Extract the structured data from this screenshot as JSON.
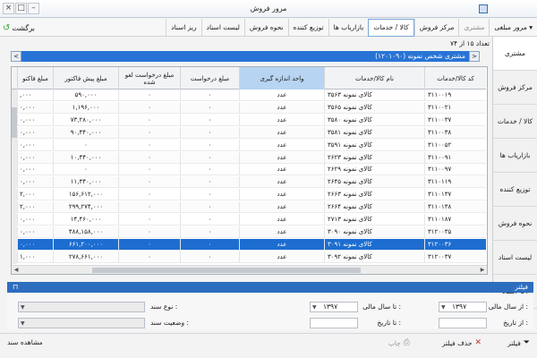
{
  "window": {
    "title": "مرور فروش"
  },
  "toolbar": {
    "back_label": "برگشت",
    "tabs": [
      {
        "label": "مرور مبلغی",
        "dropdown": true
      },
      {
        "label": "مشتری",
        "disabled": true
      },
      {
        "label": "مرکز فروش"
      },
      {
        "label": "کالا / خدمات",
        "active": true
      },
      {
        "label": "بازاریاب ها"
      },
      {
        "label": "توزیع کننده"
      },
      {
        "label": "نحوه فروش"
      },
      {
        "label": "لیست اسناد"
      },
      {
        "label": "ریز اسناد"
      }
    ]
  },
  "sidebar": {
    "items": [
      {
        "label": "مشتری",
        "active": true
      },
      {
        "label": "مرکز فروش"
      },
      {
        "label": "کالا / خدمات"
      },
      {
        "label": "بازاریاب ها"
      },
      {
        "label": "توزیع کننده"
      },
      {
        "label": "نحوه فروش"
      },
      {
        "label": "لیست اسناد"
      },
      {
        "label": "ریز اسناد"
      }
    ]
  },
  "header": {
    "count": "تعداد ۱۵ از ۷۴",
    "customer": "مشتری شخص نمونه (۱۲۰۱۰۹۰)",
    "prev": "<",
    "next": ">"
  },
  "grid": {
    "columns": [
      "کد کالا/خدمات",
      "نام کالا/خدمات",
      "واحد اندازه گیری",
      "مبلغ درخواست",
      "مبلغ درخواست لغو شده",
      "مبلغ پیش فاکتور",
      "مبلغ فاکتو"
    ],
    "rows": [
      [
        "۳۱۱۰۰۱۹",
        "کالای نمونه ۳۵۶۳",
        "عدد",
        "۰",
        "۰",
        "۵۹۰,۰۰۰",
        ",۰۰۰"
      ],
      [
        "۳۱۱۰۰۲۱",
        "کالای نمونه ۳۵۶۵",
        "عدد",
        "۰",
        "۰",
        "۱,۱۹۶,۰۰۰",
        "۰,۰۰۰"
      ],
      [
        "۳۱۱۰۰۳۷",
        "کالای نمونه ۳۵۸۰",
        "عدد",
        "۰",
        "۰",
        "۷۳,۲۸۰,۰۰۰",
        "۰,۰۰۰"
      ],
      [
        "۳۱۱۰۰۳۸",
        "کالای نمونه ۳۵۸۱",
        "عدد",
        "۰",
        "۰",
        "۹۰,۴۴۰,۰۰۰",
        "۰,۰۰۰"
      ],
      [
        "۳۱۱۰۰۵۲",
        "کالای نمونه ۳۵۹۱",
        "عدد",
        "۰",
        "۰",
        "۰",
        "۰,۰۰۰"
      ],
      [
        "۳۱۱۰۰۹۱",
        "کالای نمونه ۲۶۲۳",
        "عدد",
        "۰",
        "۰",
        "۱۰,۴۴۰,۰۰۰",
        "۰,۰۰۰"
      ],
      [
        "۳۱۱۰۰۹۷",
        "کالای نمونه ۲۶۲۹",
        "عدد",
        "۰",
        "۰",
        "۰",
        "۰,۰۰۰"
      ],
      [
        "۳۱۱۰۱۱۹",
        "کالای نمونه ۲۶۴۵",
        "عدد",
        "۰",
        "۰",
        "۱۱,۴۴۰,۰۰۰",
        "۰,۰۰۰"
      ],
      [
        "۳۱۱۰۱۳۷",
        "کالای نمونه ۲۶۶۳",
        "عدد",
        "۰",
        "۰",
        "۱۵۶,۶۱۲,۰۰۰",
        "۲,۰۰۰"
      ],
      [
        "۳۱۱۰۱۳۸",
        "کالای نمونه ۲۶۶۴",
        "عدد",
        "۰",
        "۰",
        "۲۹۹,۲۷۴,۰۰۰",
        "۲,۰۰۰"
      ],
      [
        "۳۱۱۰۱۸۷",
        "کالای نمونه ۲۷۱۳",
        "عدد",
        "۰",
        "۰",
        "۱۴,۴۶۰,۰۰۰",
        "۰,۰۰۰"
      ],
      [
        "۳۱۲۰۰۳۵",
        "کالای نمونه ۳۰۹۰",
        "عدد",
        "۰",
        "۰",
        "۴۸۸,۱۵۸,۰۰۰",
        "۰,۰۰۰"
      ],
      [
        "۳۱۲۰۰۳۶",
        "کالای نمونه ۳۰۹۱",
        "عدد",
        "۰",
        "۰",
        "۶۶۱,۲۰۰,۰۰۰",
        "۰,۰۰۰"
      ],
      [
        "۳۱۲۰۰۳۷",
        "کالای نمونه ۳۰۹۲",
        "عدد",
        "۰",
        "۰",
        "۲۷۸,۶۶۱,۰۰۰",
        "۱,۰۰۰"
      ]
    ],
    "selected_row": 12
  },
  "filter": {
    "title": "فیلتر",
    "from_year_label": "از سال مالی :",
    "from_year_value": "۱۳۹۷",
    "to_year_label": "تا سال مالی :",
    "to_year_value": "۱۳۹۷",
    "from_date_label": "از تاریخ :",
    "to_date_label": "تا تاریخ :",
    "doc_type_label": "نوع سند :",
    "doc_status_label": "وضعیت سند :"
  },
  "bottom": {
    "filter_btn": "فیلتر",
    "clear_filter_btn": "حذف فیلتر",
    "print_btn": "چاپ",
    "view_doc_btn": "مشاهده سند"
  },
  "colors": {
    "accent": "#2874d6",
    "selected_row": "#1d6dd1",
    "filter_bar": "#2d6dbe",
    "highlight_header": "#b7d4f2"
  }
}
